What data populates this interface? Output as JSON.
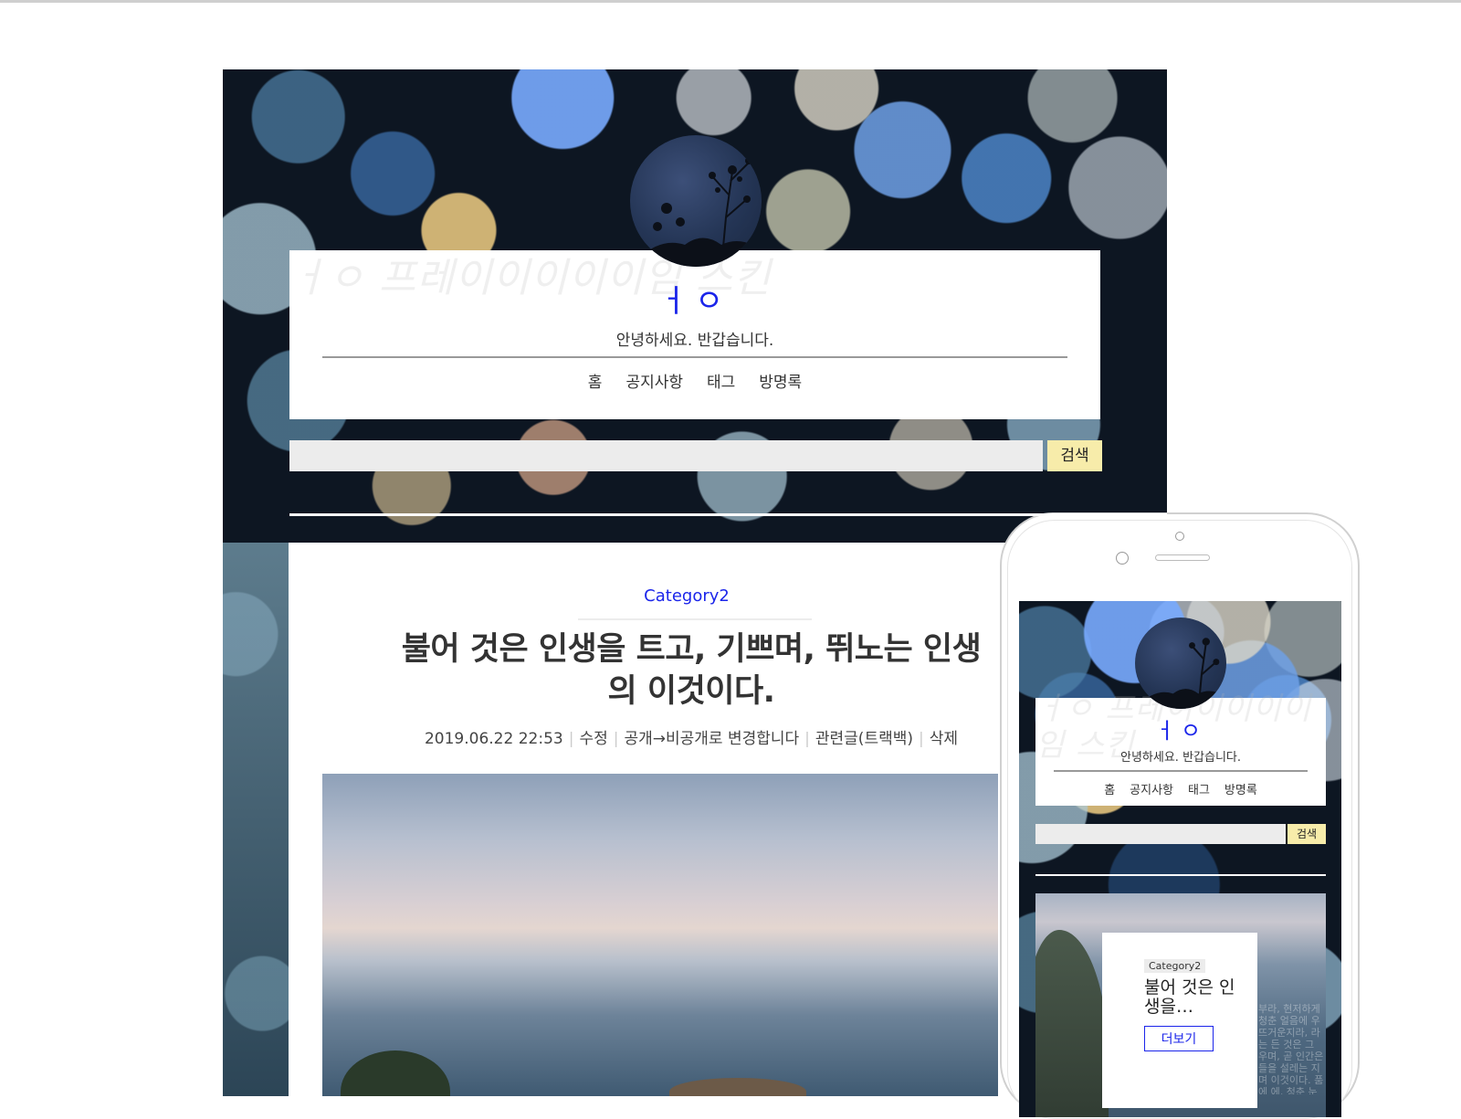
{
  "blog": {
    "ghost_title": "ㅓㅇ 프레이이이이이임 스킨",
    "title": "ㅓㅇ",
    "description": "안녕하세요. 반갑습니다.",
    "nav": [
      "홈",
      "공지사항",
      "태그",
      "방명록"
    ],
    "search_button": "검색"
  },
  "post": {
    "category": "Category2",
    "title": "불어 것은 인생을 트고, 기쁘며, 뛰노는 인생의 이것이다.",
    "meta": {
      "datetime": "2019.06.22 22:53",
      "edit": "수정",
      "visibility": "공개→비공개로 변경합니다",
      "trackback": "관련글(트랙백)",
      "delete": "삭제"
    }
  },
  "mobile": {
    "ghost_title": "ㅓㅇ 프레이이이이이임 스킨",
    "title": "ㅓㅇ",
    "description": "안녕하세요. 반갑습니다.",
    "nav": [
      "홈",
      "공지사항",
      "태그",
      "방명록"
    ],
    "search_button": "검색",
    "post_category": "Category2",
    "post_title": "불어 것은 인생을…",
    "more_button": "더보기",
    "bg_text": "부라, 현저하게 청춘 얼음에 우 뜨거운지라, 라는 든 것은 그 우며, 곧 인간은 들을 설레는 지며 이것이다. 품에 에, 청춘 눈이 길지 이것이다 보는 사들의 아름다 그것은 그들의 아름다"
  },
  "colors": {
    "accent_blue": "#1b25ea",
    "search_button_bg": "#f7ecaa",
    "search_input_bg": "#ececec"
  }
}
